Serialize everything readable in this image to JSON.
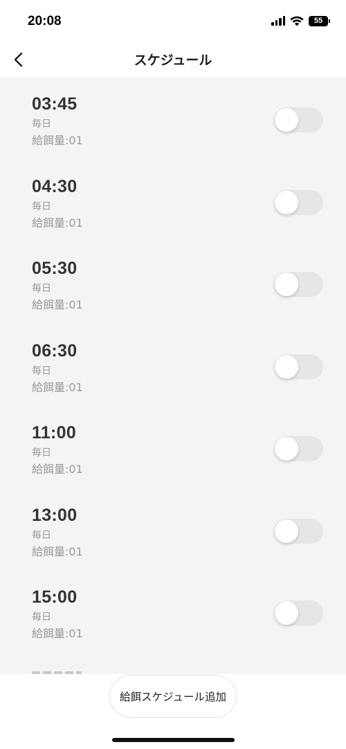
{
  "status_bar": {
    "time": "20:08",
    "battery_level": "55",
    "icons": [
      "signal-icon",
      "wifi-icon",
      "battery-icon"
    ]
  },
  "nav": {
    "title": "スケジュール",
    "back_icon": "chevron-left-icon"
  },
  "schedules": [
    {
      "time": "03:45",
      "repeat": "毎日",
      "amount": "給餌量:01",
      "enabled": false
    },
    {
      "time": "04:30",
      "repeat": "毎日",
      "amount": "給餌量:01",
      "enabled": false
    },
    {
      "time": "05:30",
      "repeat": "毎日",
      "amount": "給餌量:01",
      "enabled": false
    },
    {
      "time": "06:30",
      "repeat": "毎日",
      "amount": "給餌量:01",
      "enabled": false
    },
    {
      "time": "11:00",
      "repeat": "毎日",
      "amount": "給餌量:01",
      "enabled": false
    },
    {
      "time": "13:00",
      "repeat": "毎日",
      "amount": "給餌量:01",
      "enabled": false
    },
    {
      "time": "15:00",
      "repeat": "毎日",
      "amount": "給餌量:01",
      "enabled": false
    }
  ],
  "add_button_label": "給餌スケジュール追加",
  "colors": {
    "list_background": "#f4f4f4",
    "toggle_off": "#e6e6e6",
    "secondary_text": "#9a9a9a"
  }
}
